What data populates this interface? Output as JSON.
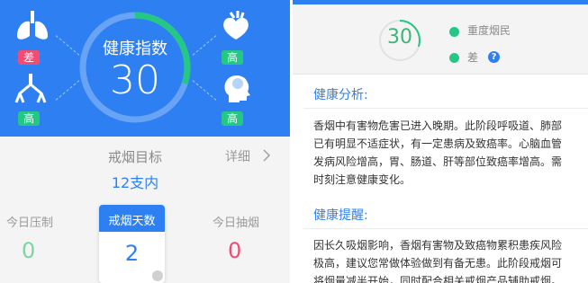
{
  "left": {
    "gauge": {
      "label": "健康指数",
      "value": "30",
      "progress": 0.3
    },
    "organs": [
      {
        "name": "lungs",
        "icon": "lungs-icon",
        "level": "差"
      },
      {
        "name": "heart",
        "icon": "heart-icon",
        "level": "高"
      },
      {
        "name": "bronchi",
        "icon": "bronchi-icon",
        "level": "高"
      },
      {
        "name": "brain",
        "icon": "brain-head-icon",
        "level": "高"
      }
    ],
    "goal": {
      "title": "戒烟目标",
      "value": "12支内",
      "detail": "详细"
    },
    "stats": {
      "pressed_label": "今日压制",
      "pressed_value": "0",
      "days_label": "戒烟天数",
      "days_value": "2",
      "smoked_label": "今日抽烟",
      "smoked_value": "0"
    }
  },
  "right": {
    "score": "30",
    "rank": "重度烟民",
    "status": "差",
    "help": "?",
    "analysis_title": "健康分析:",
    "analysis_lines": [
      "香烟中有害物危害已进入晚期。此阶段呼吸道、肺部",
      "已有明显不适症状，有一定患病及致癌率。心脑血管",
      "发病风险增高，胃、肠道、肝等部位致癌率增高。需",
      "时刻注意健康变化。"
    ],
    "tip_title": "健康提醒:",
    "tip_lines": [
      "因长久吸烟影响，香烟有害物及致癌物累积患疾风险",
      "极高，建议您常做体验做到有备无患。此阶段戒烟可",
      "将烟量减半开始，同时配合相关戒烟产品辅助戒烟。"
    ]
  },
  "colors": {
    "primary": "#2e80f2",
    "good": "#24c783",
    "bad": "#f24c72",
    "gauge_arc": "#24c783"
  }
}
